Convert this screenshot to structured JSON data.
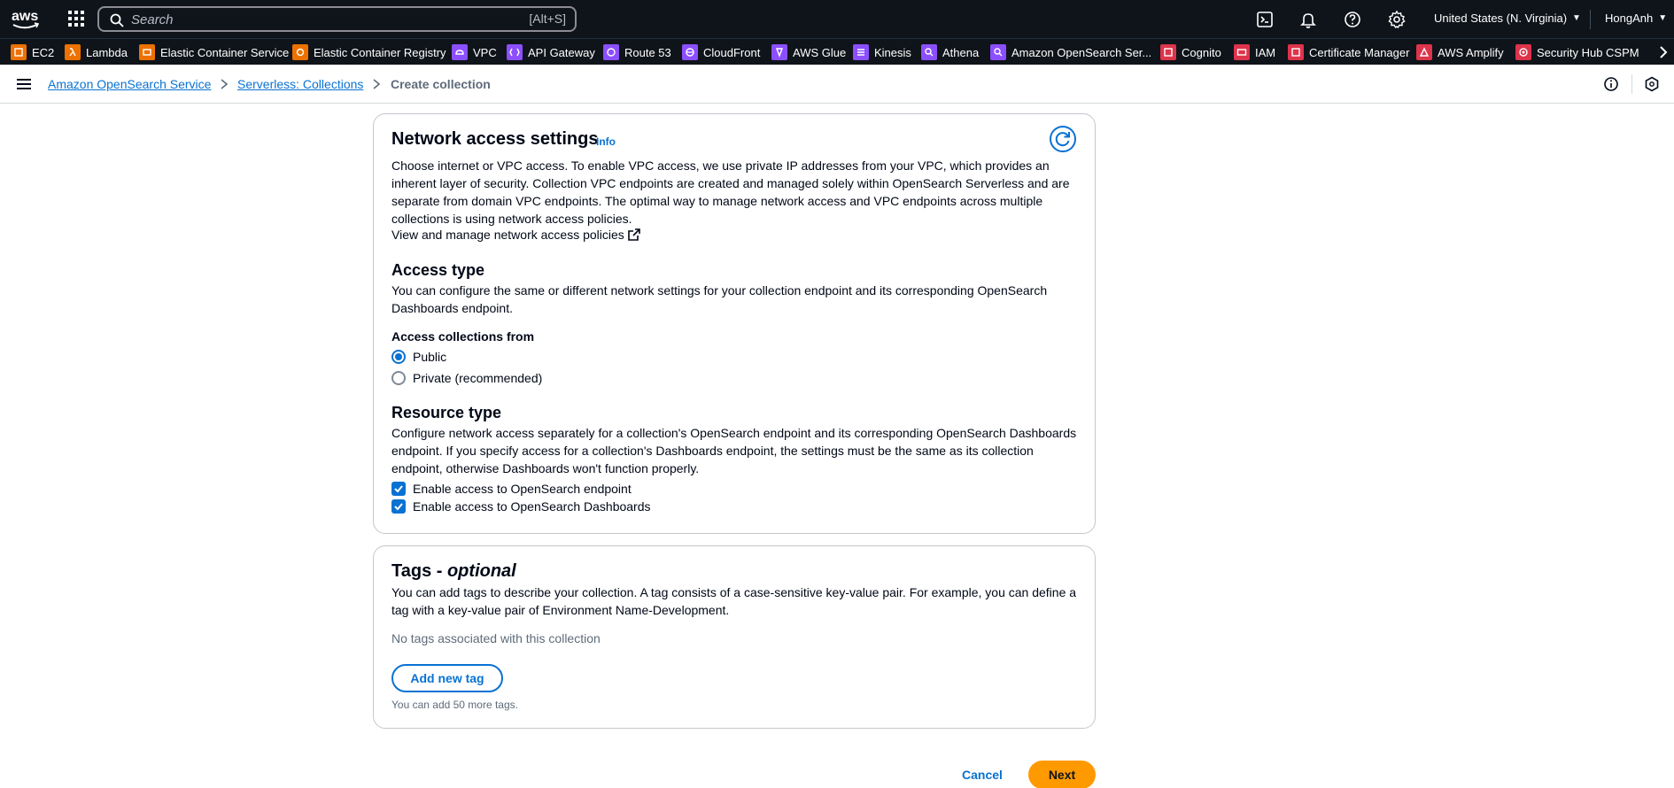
{
  "topnav": {
    "logo_text": "aws",
    "search_placeholder": "Search",
    "search_shortcut": "[Alt+S]",
    "region": "United States (N. Virginia)",
    "user": "HongAnh"
  },
  "favorites": [
    {
      "label": "EC2",
      "color": "#ed7100",
      "icon": "ec2-icon"
    },
    {
      "label": "Lambda",
      "color": "#ed7100",
      "icon": "lambda-icon"
    },
    {
      "label": "Elastic Container Service",
      "color": "#ed7100",
      "icon": "ecs-icon"
    },
    {
      "label": "Elastic Container Registry",
      "color": "#ed7100",
      "icon": "ecr-icon"
    },
    {
      "label": "VPC",
      "color": "#8c4fff",
      "icon": "vpc-icon"
    },
    {
      "label": "API Gateway",
      "color": "#8c4fff",
      "icon": "api-gateway-icon"
    },
    {
      "label": "Route 53",
      "color": "#8c4fff",
      "icon": "route53-icon"
    },
    {
      "label": "CloudFront",
      "color": "#8c4fff",
      "icon": "cloudfront-icon"
    },
    {
      "label": "AWS Glue",
      "color": "#8c4fff",
      "icon": "glue-icon"
    },
    {
      "label": "Kinesis",
      "color": "#8c4fff",
      "icon": "kinesis-icon"
    },
    {
      "label": "Athena",
      "color": "#8c4fff",
      "icon": "athena-icon"
    },
    {
      "label": "Amazon OpenSearch Ser...",
      "color": "#8c4fff",
      "icon": "opensearch-icon"
    },
    {
      "label": "Cognito",
      "color": "#dd344c",
      "icon": "cognito-icon"
    },
    {
      "label": "IAM",
      "color": "#dd344c",
      "icon": "iam-icon"
    },
    {
      "label": "Certificate Manager",
      "color": "#dd344c",
      "icon": "certificate-manager-icon"
    },
    {
      "label": "AWS Amplify",
      "color": "#dd344c",
      "icon": "amplify-icon"
    },
    {
      "label": "Security Hub CSPM",
      "color": "#dd344c",
      "icon": "security-hub-icon"
    }
  ],
  "breadcrumb": {
    "items": [
      "Amazon OpenSearch Service",
      "Serverless: Collections"
    ],
    "current": "Create collection"
  },
  "network": {
    "title": "Network access settings",
    "info": "Info",
    "description": "Choose internet or VPC access. To enable VPC access, we use private IP addresses from your VPC, which provides an inherent layer of security. Collection VPC endpoints are created and managed solely within OpenSearch Serverless and are separate from domain VPC endpoints. The optimal way to manage network access and VPC endpoints across multiple collections is using network access policies.",
    "policies_link": "View and manage network access policies",
    "access_type": {
      "title": "Access type",
      "description": "You can configure the same or different network settings for your collection endpoint and its corresponding OpenSearch Dashboards endpoint.",
      "label": "Access collections from",
      "options": [
        "Public",
        "Private (recommended)"
      ],
      "selected": "Public"
    },
    "resource_type": {
      "title": "Resource type",
      "description": "Configure network access separately for a collection's OpenSearch endpoint and its corresponding OpenSearch Dashboards endpoint. If you specify access for a collection's Dashboards endpoint, the settings must be the same as its collection endpoint, otherwise Dashboards won't function properly.",
      "checkboxes": [
        {
          "label": "Enable access to OpenSearch endpoint",
          "checked": true
        },
        {
          "label": "Enable access to OpenSearch Dashboards",
          "checked": true
        }
      ]
    }
  },
  "tags": {
    "title": "Tags - ",
    "title_optional": "optional",
    "description": "You can add tags to describe your collection. A tag consists of a case-sensitive key-value pair. For example, you can define a tag with a key-value pair of Environment Name-Development.",
    "empty": "No tags associated with this collection",
    "add_button": "Add new tag",
    "limit": "You can add 50 more tags."
  },
  "actions": {
    "cancel": "Cancel",
    "next": "Next"
  }
}
